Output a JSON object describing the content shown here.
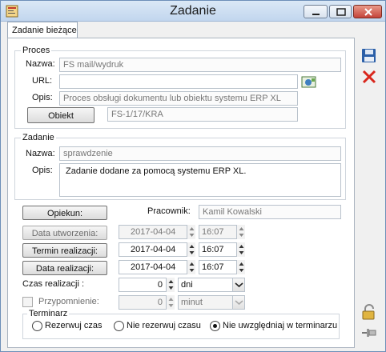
{
  "window": {
    "title": "Zadanie"
  },
  "tab": {
    "label": "Zadanie bieżące"
  },
  "proces": {
    "group_label": "Proces",
    "nazwa_label": "Nazwa:",
    "nazwa_value": "FS mail/wydruk",
    "url_label": "URL:",
    "url_value": "",
    "opis_label": "Opis:",
    "opis_value": "Proces obsługi dokumentu lub obiektu systemu ERP XL",
    "obiekt_button": "Obiekt",
    "obiekt_value": "FS-1/17/KRA"
  },
  "zadanie": {
    "group_label": "Zadanie",
    "nazwa_label": "Nazwa:",
    "nazwa_value": "sprawdzenie",
    "opis_label": "Opis:",
    "opis_value": "Zadanie dodane za pomocą systemu ERP XL."
  },
  "people": {
    "opiekun_button": "Opiekun:",
    "pracownik_label": "Pracownik:",
    "pracownik_value": "Kamil Kowalski"
  },
  "dates": [
    {
      "label": "Data utworzenia:",
      "date": "2017-04-04",
      "time": "16:07",
      "enabled": false
    },
    {
      "label": "Termin realizacji:",
      "date": "2017-04-04",
      "time": "16:07",
      "enabled": true
    },
    {
      "label": "Data realizacji:",
      "date": "2017-04-04",
      "time": "16:07",
      "enabled": true
    }
  ],
  "czas": {
    "label": "Czas realizacji :",
    "value": "0",
    "unit": "dni"
  },
  "przypomnienie": {
    "label": "Przypomnienie:",
    "value": "0",
    "unit": "minut",
    "checked": false
  },
  "terminarz": {
    "group_label": "Terminarz",
    "options": [
      "Rezerwuj czas",
      "Nie rezerwuj czasu",
      "Nie uwzględniaj w terminarzu"
    ],
    "selected": 2
  },
  "icons": [
    "save-icon",
    "delete-icon",
    "browse-url-icon",
    "unlock-icon",
    "pin-icon",
    "app-icon"
  ],
  "colors": {
    "accent": "#2b5fa8",
    "delete": "#d9261c",
    "disabled_text": "#6d6d6d"
  }
}
